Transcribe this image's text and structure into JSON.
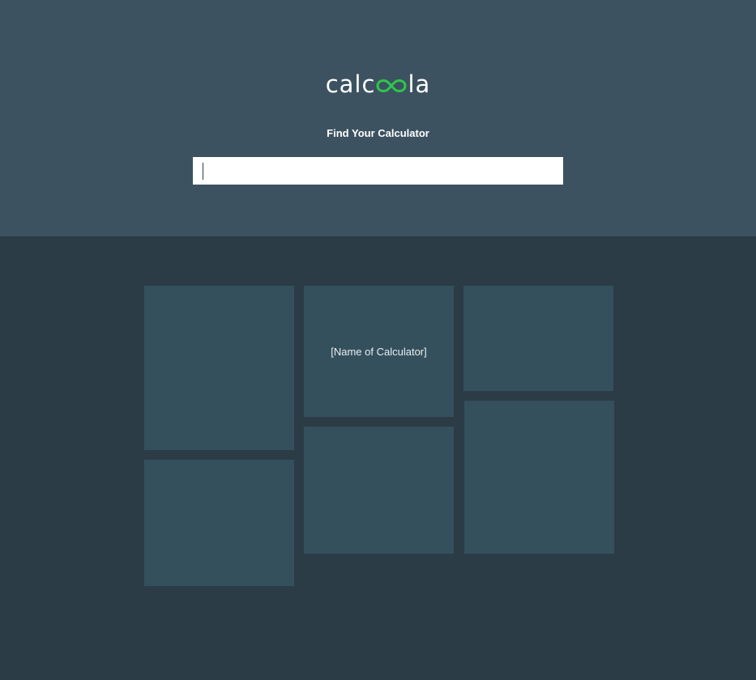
{
  "brand": {
    "logo_left": "calc",
    "logo_mark": "infinity-icon",
    "logo_right": "la",
    "accent_color": "#2ec64a"
  },
  "search": {
    "heading": "Find Your Calculator",
    "value": "",
    "placeholder": ""
  },
  "tiles": [
    {
      "label": ""
    },
    {
      "label": "[Name of Calculator]"
    },
    {
      "label": ""
    },
    {
      "label": ""
    },
    {
      "label": ""
    },
    {
      "label": ""
    }
  ],
  "colors": {
    "header_bg": "#3c5260",
    "page_bg": "#2b3c47",
    "tile_bg": "#35505d"
  }
}
